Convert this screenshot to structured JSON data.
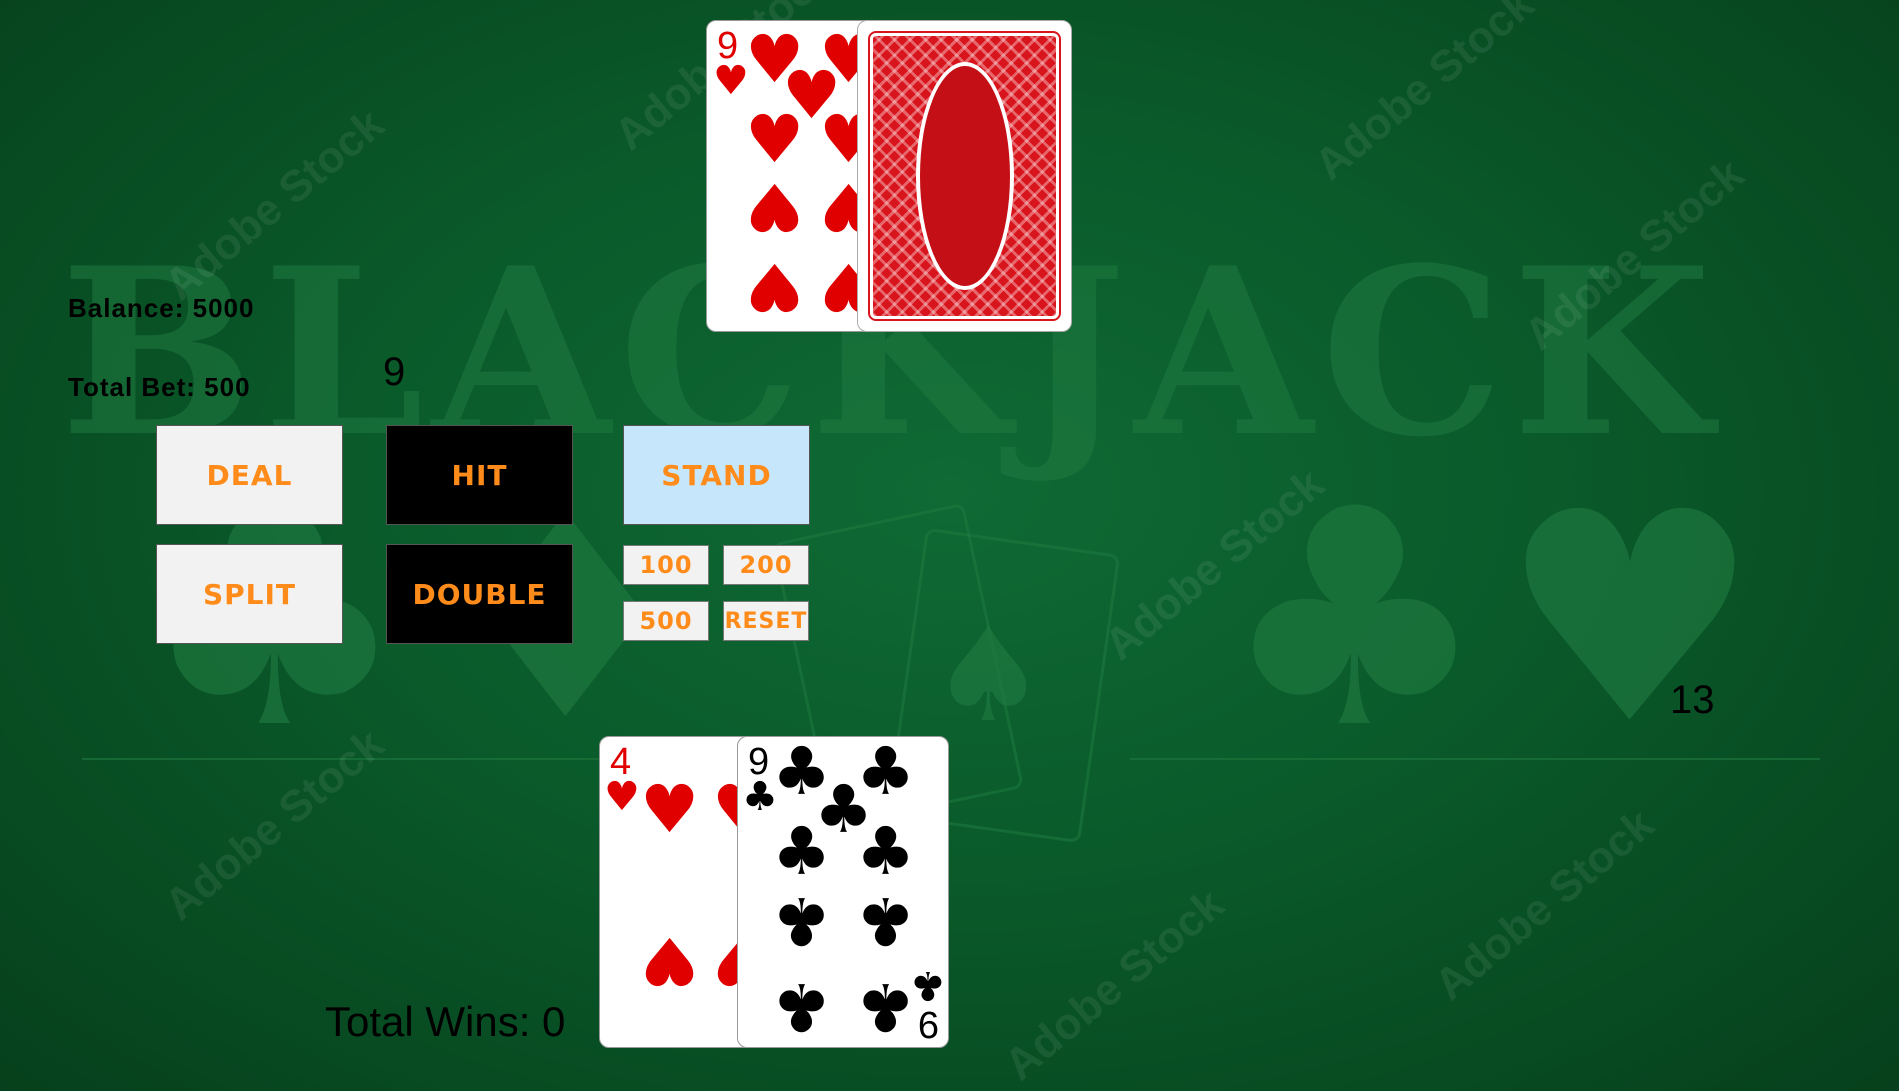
{
  "background": {
    "title_word": "BLACKJACK",
    "watermark": "Adobe Stock",
    "colors": {
      "felt": "#0a5a2a",
      "felt_text": "#1f7a40"
    }
  },
  "info": {
    "balance_label": "Balance: 5000",
    "total_bet_label": "Total Bet: 500"
  },
  "scores": {
    "dealer": "9",
    "player": "13"
  },
  "buttons": {
    "deal": "Deal",
    "hit": "Hit",
    "stand": "Stand",
    "split": "Split",
    "double": "Double",
    "chip_100": "100",
    "chip_200": "200",
    "chip_500": "500",
    "reset": "Reset"
  },
  "dealer_hand": {
    "cards": [
      {
        "rank": "9",
        "suit": "hearts",
        "face": "up"
      },
      {
        "face": "down"
      }
    ]
  },
  "player_hand": {
    "cards": [
      {
        "rank": "4",
        "suit": "hearts",
        "face": "up"
      },
      {
        "rank": "9",
        "suit": "clubs",
        "face": "up"
      }
    ]
  },
  "footer": {
    "total_wins_label": "Total Wins: 0"
  },
  "colors": {
    "button_text": "#ff8c1a",
    "stand_bg": "#c6e6fb",
    "red_suit": "#e10000"
  }
}
